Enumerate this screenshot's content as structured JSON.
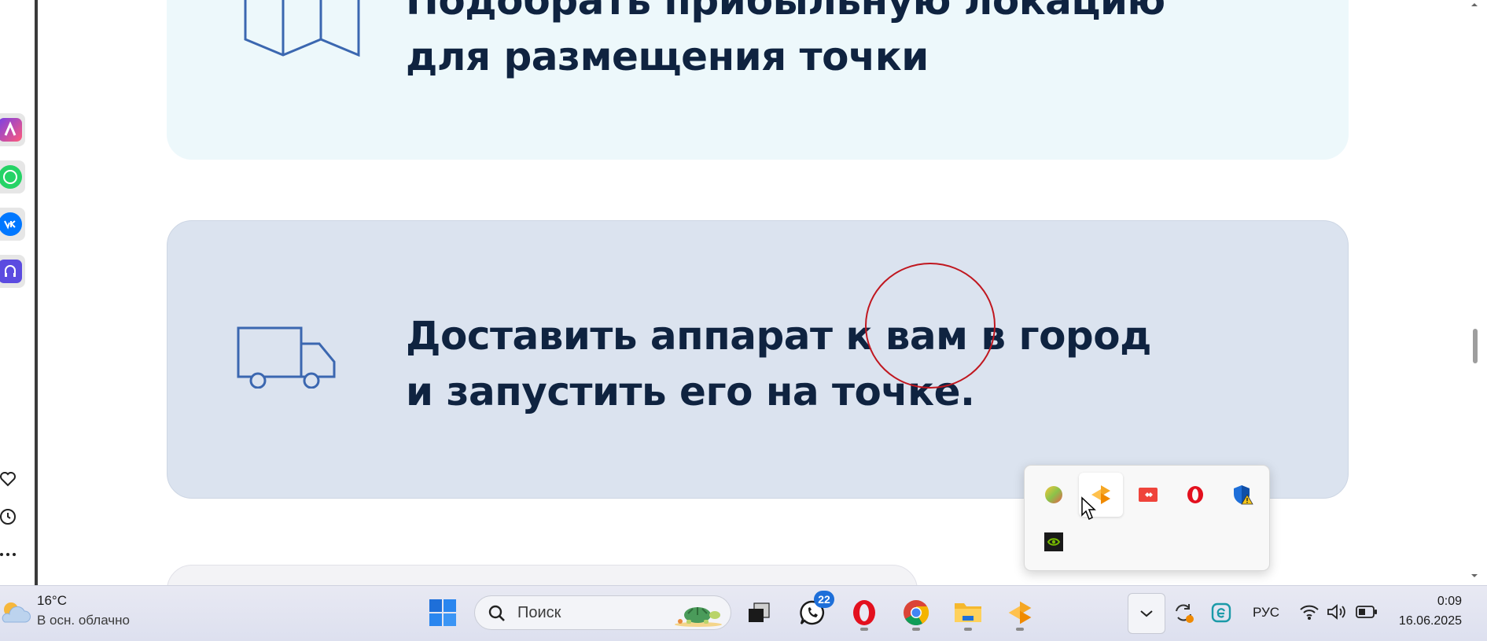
{
  "page": {
    "card1_title_line1": "Подобрать прибыльную локацию",
    "card1_title_line2": "для размещения точки",
    "card2_title_line1": "Доставить аппарат к вам в город",
    "card2_title_line2": "и запустить его на точке."
  },
  "taskbar": {
    "weather_temp": "16°C",
    "weather_desc": "В осн. облачно",
    "search_placeholder": "Поиск",
    "whatsapp_badge": "22",
    "language": "РУС",
    "time": "0:09",
    "date": "16.06.2025"
  },
  "colors": {
    "accent_blue": "#1e6fd9",
    "heading_text": "#0f2340",
    "card_light": "#edf8fb",
    "card_blue": "#dbe3ef",
    "annotation_red": "#c0171f"
  },
  "icons": {
    "sidebar": [
      "alice-icon",
      "whatsapp-icon",
      "vk-icon",
      "music-icon",
      "heart-icon",
      "history-icon",
      "more-icon"
    ],
    "tray": [
      "color-app-icon",
      "yandex-app-icon",
      "anydesk-icon",
      "opera-icon",
      "defender-warning-icon",
      "nvidia-icon"
    ],
    "taskbar": [
      "windows-start-icon",
      "search-icon",
      "task-view-icon",
      "whatsapp-icon",
      "opera-icon",
      "chrome-icon",
      "file-explorer-icon",
      "yandex-app-icon",
      "chevron-up-icon",
      "sync-icon",
      "edge-icon",
      "wifi-icon",
      "volume-icon",
      "battery-icon"
    ]
  }
}
